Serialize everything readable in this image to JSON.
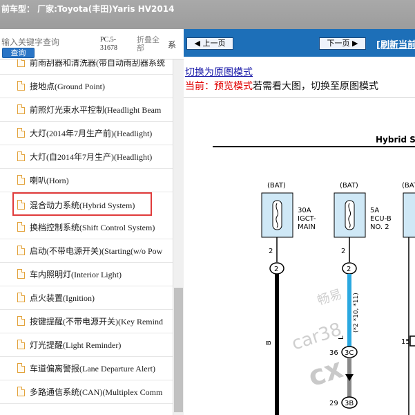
{
  "window": {
    "title": "前车型：  厂家:Toyota(丰田)Yaris HV2014"
  },
  "sidebar": {
    "search_placeholder": "输入关键字查询",
    "search_button": "查询",
    "pc_code": "PC.5-31678",
    "collapse_all": "折叠全部",
    "system_tab": "系",
    "items": [
      {
        "label": "前雨刮器和清洗器(带自动雨刮器系统"
      },
      {
        "label": "接地点(Ground Point)"
      },
      {
        "label": "前照灯光束水平控制(Headlight Beam"
      },
      {
        "label": "大灯(2014年7月生产前)(Headlight)"
      },
      {
        "label": "大灯(自2014年7月生产)(Headlight)"
      },
      {
        "label": "喇叭(Horn)"
      },
      {
        "label": "混合动力系统(Hybrid System)"
      },
      {
        "label": "换档控制系统(Shift Control System)"
      },
      {
        "label": "启动(不带电源开关)(Starting(w/o Pow"
      },
      {
        "label": "车内照明灯(Interior Light)"
      },
      {
        "label": "点火装置(Ignition)"
      },
      {
        "label": "按键提醒(不带电源开关)(Key Remind"
      },
      {
        "label": "灯光提醒(Light Reminder)"
      },
      {
        "label": "车道偏离警报(Lane Departure Alert)"
      },
      {
        "label": "多路通信系统(CAN)(Multiplex Comm"
      }
    ],
    "selected_index": 6
  },
  "toolbar": {
    "prev_label": "上一页",
    "next_label": "下一页",
    "refresh_label": "[刷新当前"
  },
  "viewer": {
    "switch_link": "切换为原图模式",
    "current_label": "当前：",
    "mode_label": "预览模式",
    "hint": "若需看大图，切换至原图模式"
  },
  "diagram": {
    "title": "Hybrid S",
    "fuse1": {
      "supply": "(BAT)",
      "rating": "30A",
      "name1": "IGCT-",
      "name2": "MAIN",
      "pin": "2",
      "conn": "2"
    },
    "fuse2": {
      "supply": "(BAT)",
      "rating": "5A",
      "name1": "ECU-B",
      "name2": "NO. 2",
      "pin": "2",
      "conn": "2"
    },
    "fuse3": {
      "supply": "(BAT)"
    },
    "wire1_color": "B",
    "wire2_color": "L",
    "wire2_note": "(*2 *10, *11)",
    "junction_pin": "36",
    "junction_conn": "3C",
    "lower_pin": "29",
    "lower_conn": "3B",
    "side_pin": "15",
    "watermark1": "畅易",
    "watermark2": "car38",
    "watermark3": "cx"
  },
  "colors": {
    "titlebar": "#a3a3a3",
    "navbar": "#1d6fb8",
    "selected_border": "#e03a3a",
    "fuse_fill": "#cfe8f6",
    "wire_blue": "#2aa8e0"
  }
}
